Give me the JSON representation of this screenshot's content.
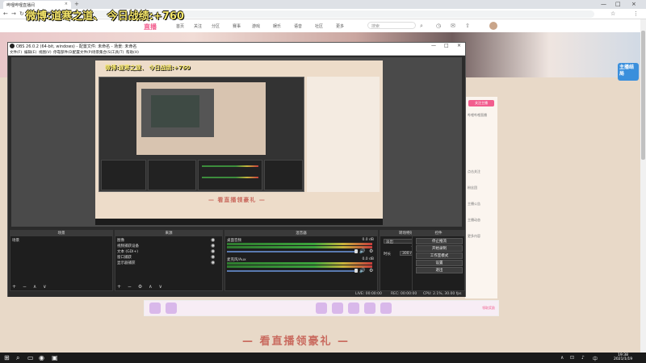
{
  "overlay": {
    "title": "微博:道寒之道、  今日战绩:+760"
  },
  "browser": {
    "tab_title": "哔哩哔哩直播间",
    "tab_close": "×",
    "new_tab": "+",
    "win_min": "—",
    "win_max": "□",
    "win_close": "×",
    "back": "←",
    "forward": "→",
    "reload": "↻",
    "url": "live.bilibili.com",
    "icons": {
      "star": "☆",
      "menu": "⋮"
    }
  },
  "site": {
    "logo": "直播",
    "nav": [
      "首页",
      "关注",
      "分区",
      "赛事",
      "游戏",
      "娱乐",
      "语音",
      "社区",
      "更多"
    ],
    "search_placeholder": "搜索",
    "sidebar_button": "关注主播",
    "sidebar_lines": [
      "哔哩哔哩直播",
      "点击关注",
      "粉丝团",
      "主播公告",
      "主播动态",
      "更多内容"
    ],
    "banner_badge": "主播结局",
    "promo_btn": "领取奖励",
    "footer_banner": "— 看直播领豪礼 —"
  },
  "obs": {
    "title": "OBS 26.0.2 (64-bit, windows) - 配置文件: 未命名 - 场景: 未命名",
    "win_min": "—",
    "win_max": "□",
    "win_close": "×",
    "menu": [
      "文件(F)",
      "编辑(E)",
      "视图(V)",
      "停靠部件(D)",
      "配置文件(P)",
      "场景集合(S)",
      "工具(T)",
      "帮助(H)"
    ],
    "preview_inner_title": "微博:道寒之道、  今日战绩:+760",
    "preview_banner": "— 看直播领豪礼 —",
    "docks": {
      "scenes": {
        "header": "场景",
        "items": [
          "场景"
        ],
        "toolbar": "+ − ∧ ∨"
      },
      "sources": {
        "header": "来源",
        "items": [
          "图像",
          "视频捕获设备",
          "文本 (GDI+)",
          "窗口捕获",
          "显示器捕获"
        ],
        "toolbar": "+ − ⚙ ∧ ∨"
      },
      "mixer": {
        "header": "混音器",
        "channels": [
          {
            "name": "桌面音频",
            "db": "0.0 dB"
          },
          {
            "name": "麦克风/Aux",
            "db": "0.0 dB"
          }
        ]
      },
      "transitions": {
        "header": "转场特效",
        "type": "淡出",
        "duration_label": "时长",
        "duration": "300 ms"
      },
      "controls": {
        "header": "控件",
        "buttons": [
          "停止推流",
          "开始录制",
          "工作室模式",
          "设置",
          "退出"
        ]
      }
    },
    "status": {
      "live": "LIVE: 00:00:00",
      "rec": "REC: 00:00:00",
      "cpu": "CPU: 2.1%, 30.00 fps"
    }
  },
  "taskbar": {
    "start": "⊞",
    "apps": [
      "⌕",
      "▭",
      "◉",
      "▣"
    ],
    "tray": [
      "∧",
      "⊡",
      "♪",
      "中"
    ],
    "time": "19:38",
    "date": "2021/1/19"
  }
}
